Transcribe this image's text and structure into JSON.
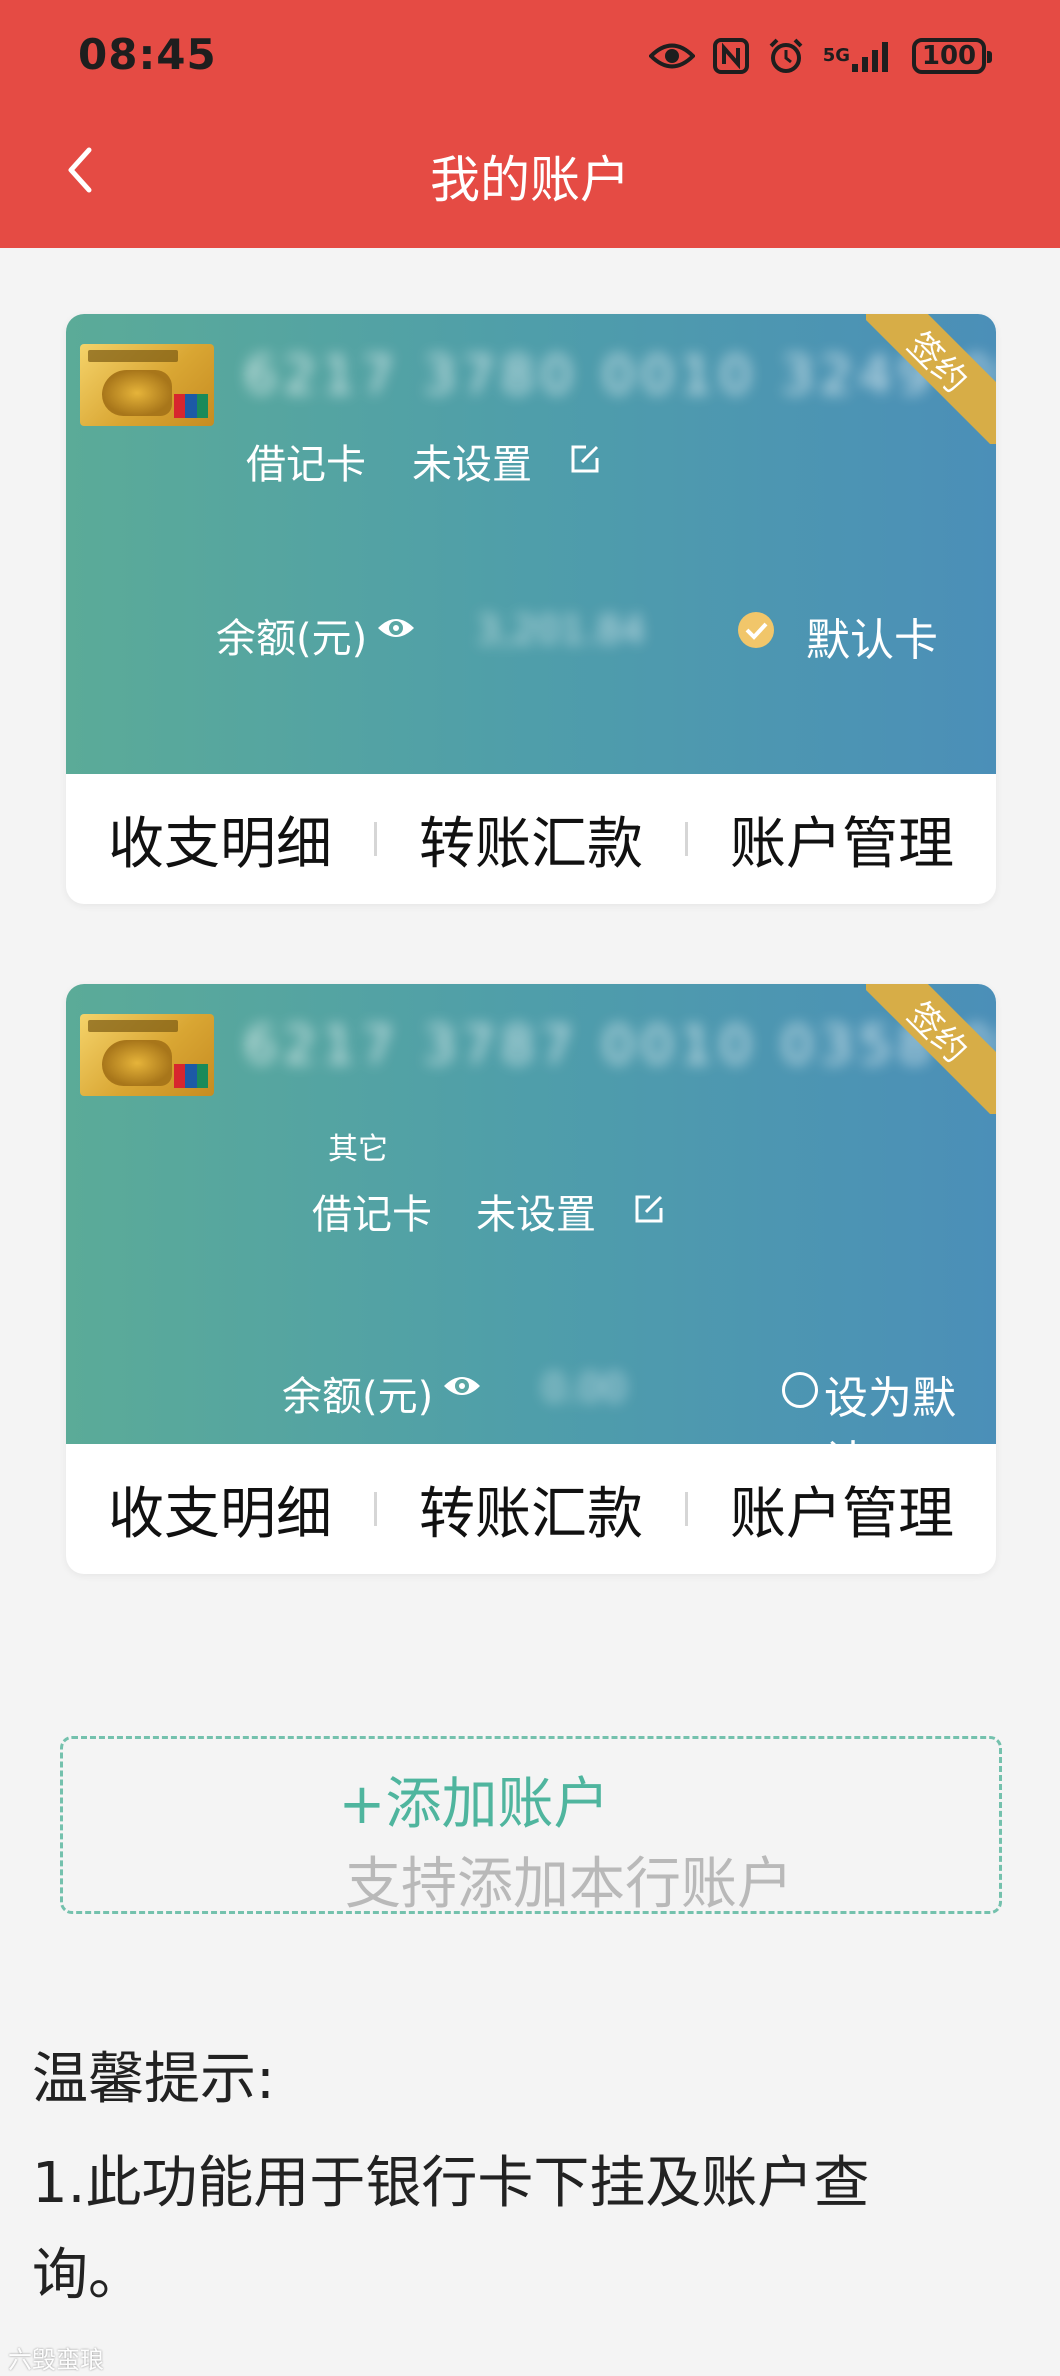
{
  "status_bar": {
    "time": "08:45",
    "network_label": "5G",
    "battery": "100",
    "icons": [
      "eye-icon",
      "nfc-icon",
      "alarm-icon",
      "signal-icon",
      "battery-icon"
    ]
  },
  "header": {
    "title": "我的账户",
    "back_icon": "chevron-left-icon",
    "background_color": "#e54b44"
  },
  "accounts": [
    {
      "card_number": "6217 3780 0010 3249 0049",
      "ribbon": "签约",
      "subtag": "",
      "card_type": "借记卡",
      "nickname": "未设置",
      "balance_label": "余额(元)",
      "balance": "3,201.84",
      "default_label": "默认卡",
      "is_default": true,
      "actions": [
        "收支明细",
        "转账汇款",
        "账户管理"
      ]
    },
    {
      "card_number": "6217 3787 0010 0358 0049",
      "ribbon": "签约",
      "subtag": "其它",
      "card_type": "借记卡",
      "nickname": "未设置",
      "balance_label": "余额(元)",
      "balance": "0.00",
      "default_label": "设为默认",
      "is_default": false,
      "actions": [
        "收支明细",
        "转账汇款",
        "账户管理"
      ]
    }
  ],
  "add_account": {
    "title": "+添加账户",
    "subtitle": "支持添加本行账户",
    "accent_color": "#4fb59e"
  },
  "tips": {
    "title": "温馨提示:",
    "body": "1.此功能用于银行卡下挂及账户查询。"
  },
  "watermark": "六毁蛮琅"
}
